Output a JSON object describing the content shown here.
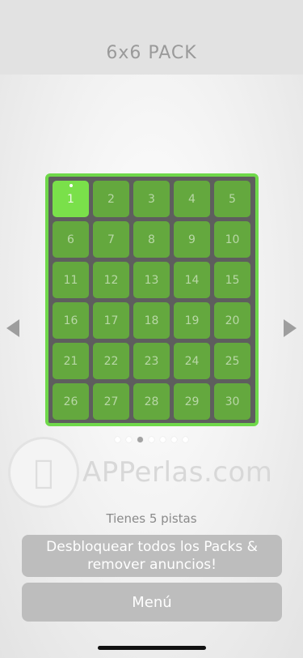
{
  "header": {
    "title": "6x6 PACK"
  },
  "levels": [
    "1",
    "2",
    "3",
    "4",
    "5",
    "6",
    "7",
    "8",
    "9",
    "10",
    "11",
    "12",
    "13",
    "14",
    "15",
    "16",
    "17",
    "18",
    "19",
    "20",
    "21",
    "22",
    "23",
    "24",
    "25",
    "26",
    "27",
    "28",
    "29",
    "30"
  ],
  "active_level": "1",
  "pagination": {
    "pages": 7,
    "current_page": 3
  },
  "watermark": {
    "text": "APPerlas.com"
  },
  "hints_text": "Tienes 5 pistas",
  "buttons": {
    "unlock_label": "Desbloquear todos los Packs & remover anuncios!",
    "menu_label": "Menú"
  },
  "colors": {
    "board_border": "#6fd84a",
    "cell": "#64a83e",
    "cell_active": "#7ae04a",
    "button": "#bdbdbd"
  },
  "icons": {
    "prev": "triangle-left-icon",
    "next": "triangle-right-icon"
  }
}
